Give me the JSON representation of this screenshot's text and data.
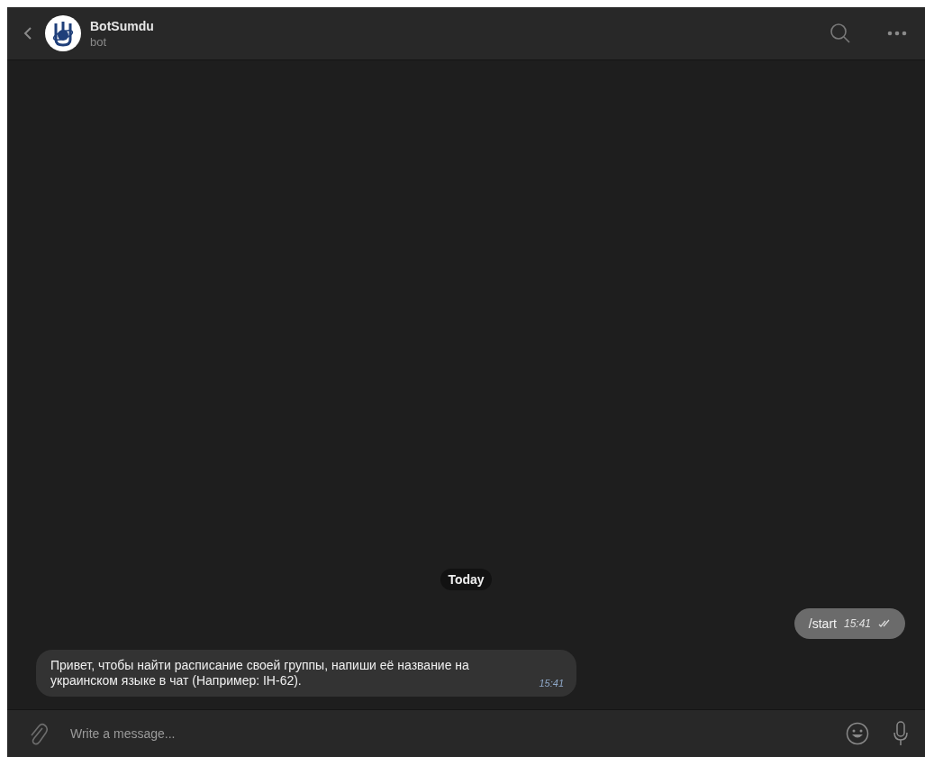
{
  "header": {
    "title": "BotSumdu",
    "subtitle": "bot"
  },
  "date_badge": "Today",
  "messages": [
    {
      "kind": "outgoing",
      "text": "/start",
      "time": "15:41",
      "read": true
    },
    {
      "kind": "incoming",
      "text": "Привет, чтобы найти расписание своей группы, напиши её название на украинском языке в чат (Например: ІН-62).",
      "time": "15:41"
    }
  ],
  "composer": {
    "placeholder": "Write a message..."
  }
}
